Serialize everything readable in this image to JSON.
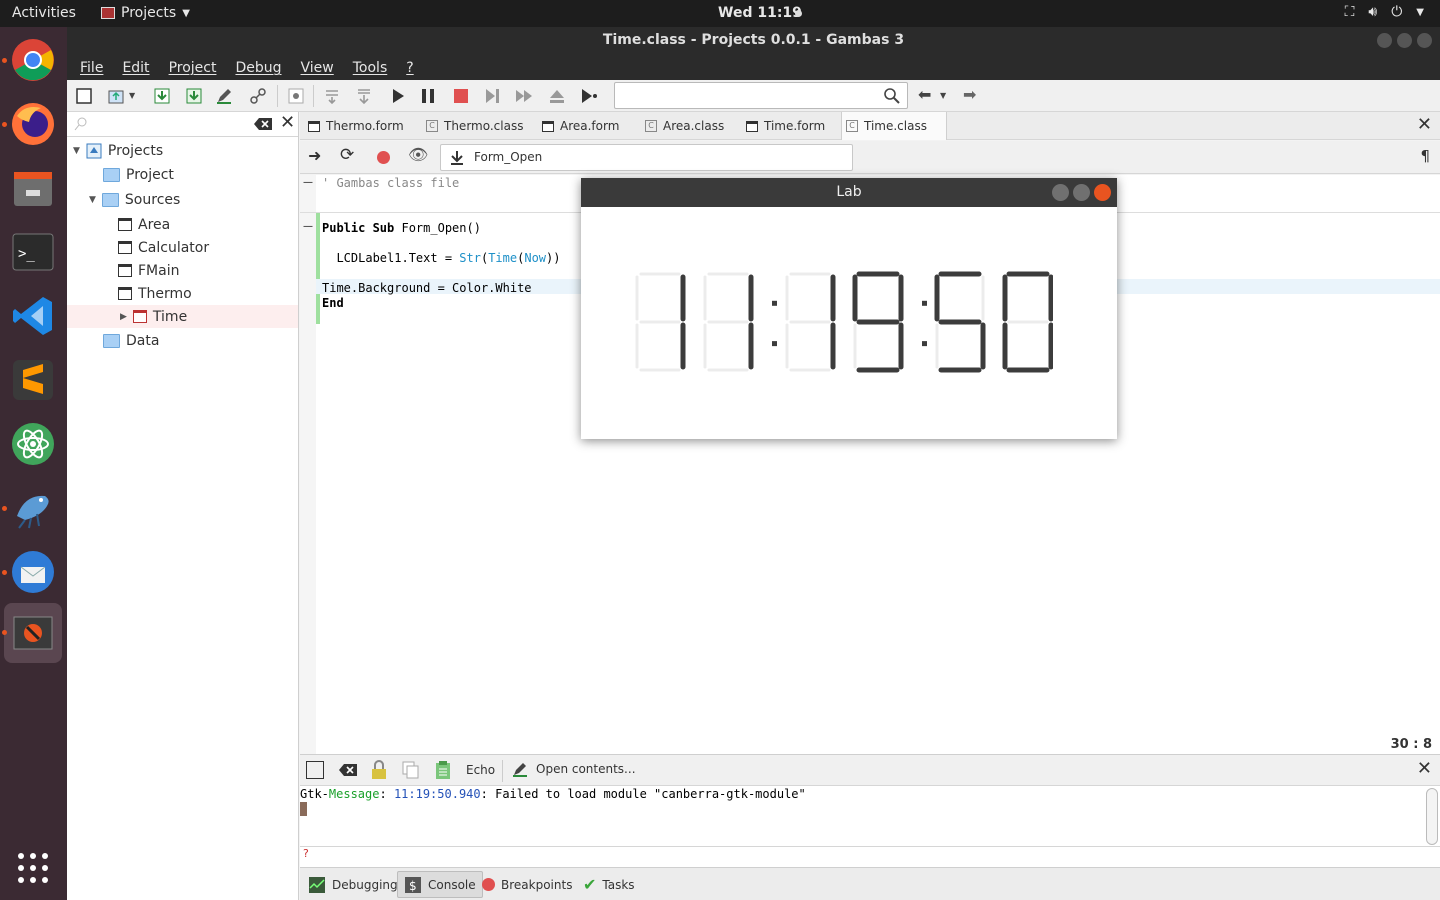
{
  "topbar": {
    "activities": "Activities",
    "app_menu": "Projects",
    "clock": "Wed 11:19"
  },
  "dock": {
    "items": [
      "chrome-icon",
      "firefox-icon",
      "files-icon",
      "terminal-icon",
      "vscode-icon",
      "sublime-icon",
      "atom-icon",
      "gambas-icon",
      "thunderbird-icon",
      "system-window-icon",
      "app-grid-icon"
    ]
  },
  "window": {
    "title": "Time.class - Projects 0.0.1 - Gambas 3",
    "menus": [
      "File",
      "Edit",
      "Project",
      "Debug",
      "View",
      "Tools",
      "?"
    ]
  },
  "tree": {
    "root": "Projects",
    "project": "Project",
    "sources": "Sources",
    "items": [
      "Area",
      "Calculator",
      "FMain",
      "Thermo",
      "Time"
    ],
    "data": "Data"
  },
  "tabs": [
    "Thermo.form",
    "Thermo.class",
    "Area.form",
    "Area.class",
    "Time.form",
    "Time.class"
  ],
  "editor": {
    "procedure": "Form_Open",
    "comment": "' Gambas class file",
    "line1_kw": "Public Sub",
    "line1_rest": " Form_Open()",
    "line2_a": "  LCDLabel1.Text = ",
    "line2_fn1": "Str",
    "line2_p1": "(",
    "line2_fn2": "Time",
    "line2_p2": "(",
    "line2_fn3": "Now",
    "line2_p3": "))",
    "line3": "Time.Background = Color.White",
    "line4": "End",
    "cursor_pos": "30 : 8"
  },
  "console": {
    "echo_label": "Echo",
    "open_label": "Open contents...",
    "msg_a": "Gtk-",
    "msg_b": "Message",
    "msg_c": ": ",
    "msg_time": "11:19:50.940",
    "msg_d": ": Failed to load module \"canberra-gtk-module\"",
    "prompt": "?"
  },
  "bottom_tabs": [
    "Debugging",
    "Console",
    "Breakpoints",
    "Tasks"
  ],
  "lab": {
    "title": "Lab",
    "time_text": "11:19:50"
  }
}
